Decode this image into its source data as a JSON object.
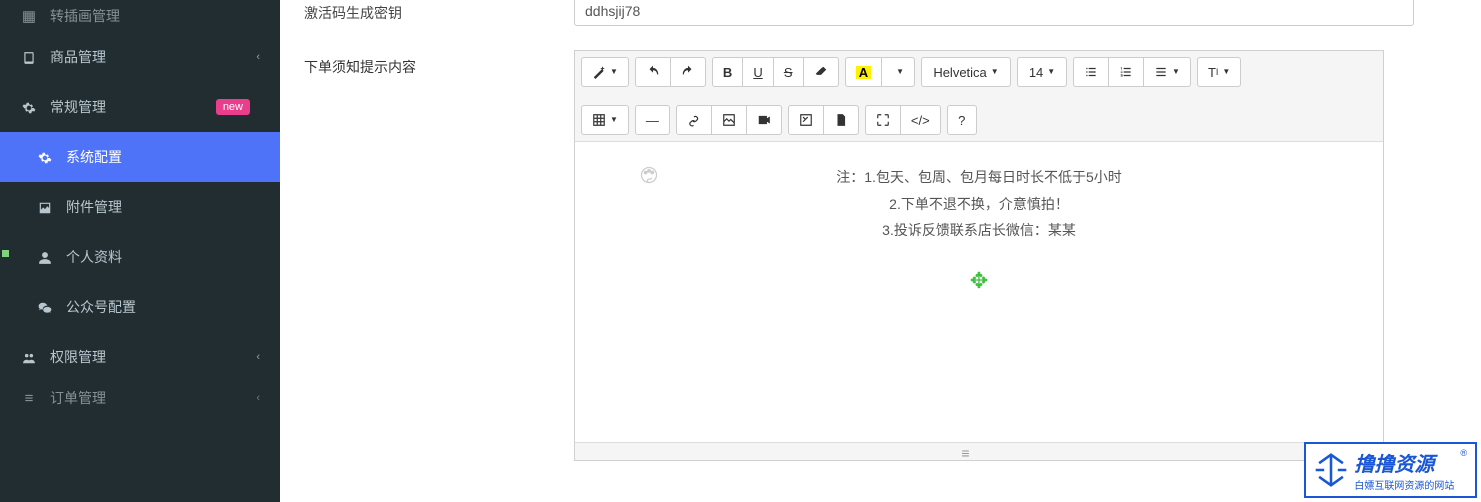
{
  "sidebar": {
    "items": [
      {
        "label": "转插画管理",
        "icon": "grid-icon"
      },
      {
        "label": "商品管理",
        "icon": "book-icon",
        "expandable": true
      },
      {
        "label": "常规管理",
        "icon": "gear-icon",
        "badge": "new"
      },
      {
        "label": "系统配置",
        "icon": "gear-icon",
        "active": true,
        "sub": true
      },
      {
        "label": "附件管理",
        "icon": "image-icon",
        "sub": true
      },
      {
        "label": "个人资料",
        "icon": "user-icon",
        "sub": true
      },
      {
        "label": "公众号配置",
        "icon": "wechat-icon",
        "sub": true
      },
      {
        "label": "权限管理",
        "icon": "users-icon",
        "expandable": true
      },
      {
        "label": "订单管理",
        "icon": "list-icon",
        "expandable": true
      }
    ]
  },
  "form": {
    "field1": {
      "label": "激活码生成密钥",
      "value": "ddhsjij78"
    },
    "field2": {
      "label": "下单须知提示内容"
    }
  },
  "editor": {
    "font_family": "Helvetica",
    "font_size": "14",
    "content": {
      "line1": "注：1.包天、包周、包月每日时长不低于5小时",
      "line2": "2.下单不退不换，介意慎拍！",
      "line3": "3.投诉反馈联系店长微信：某某"
    }
  },
  "watermark": {
    "title": "撸撸资源",
    "sub": "白嫖互联网资源的网站",
    "reg": "®"
  }
}
